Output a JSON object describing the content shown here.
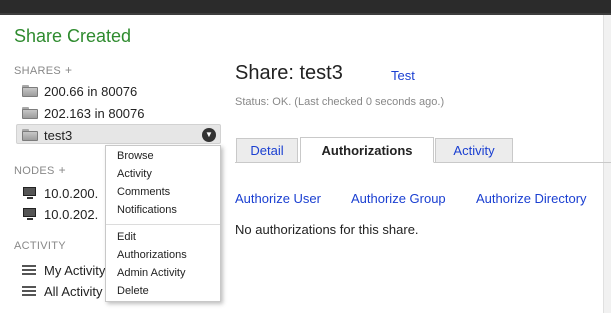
{
  "page_title": "Share Created",
  "sidebar": {
    "shares_heading": "SHARES",
    "shares_add": "+",
    "shares": [
      {
        "label": "200.66 in 80076"
      },
      {
        "label": "202.163 in 80076"
      },
      {
        "label": "test3"
      }
    ],
    "nodes_heading": "NODES",
    "nodes_add": "+",
    "nodes": [
      {
        "label": "10.0.200."
      },
      {
        "label": "10.0.202."
      }
    ],
    "activity_heading": "ACTIVITY",
    "activity": [
      {
        "label": "My Activity"
      },
      {
        "label": "All Activity"
      }
    ]
  },
  "context_menu": {
    "items_top": [
      "Browse",
      "Activity",
      "Comments",
      "Notifications"
    ],
    "items_bottom": [
      "Edit",
      "Authorizations",
      "Admin Activity",
      "Delete"
    ]
  },
  "main": {
    "share_title": "Share: test3",
    "share_link": "Test",
    "status": "Status: OK. (Last checked 0 seconds ago.)",
    "tabs": [
      {
        "label": "Detail",
        "active": false
      },
      {
        "label": "Authorizations",
        "active": true
      },
      {
        "label": "Activity",
        "active": false
      }
    ],
    "actions": [
      "Authorize User",
      "Authorize Group",
      "Authorize Directory"
    ],
    "empty_message": "No authorizations for this share."
  },
  "colors": {
    "title_green": "#2e8b2e",
    "link_blue": "#1a3fd1",
    "muted_gray": "#888888",
    "topbar": "#2b2b2b"
  },
  "icons": {
    "share": "folder-icon",
    "node": "monitor-icon",
    "activity": "list-icon",
    "dropdown": "chevron-down-icon"
  }
}
